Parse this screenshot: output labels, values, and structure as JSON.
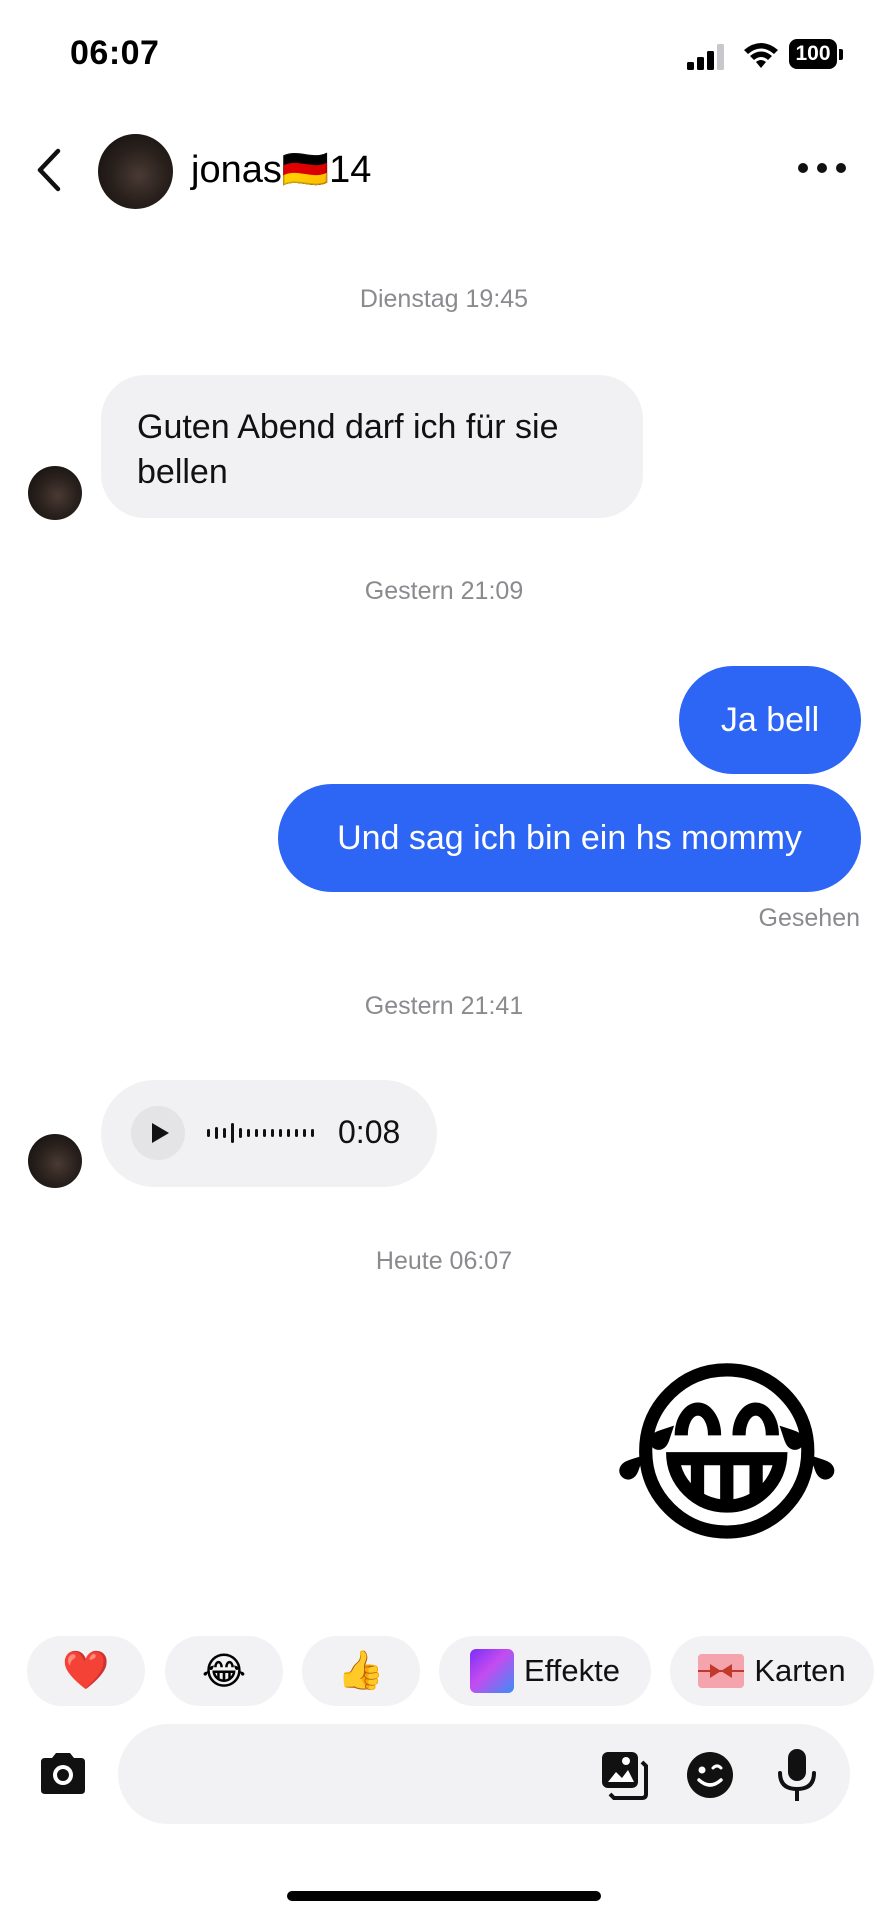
{
  "status_bar": {
    "time": "06:07",
    "battery": "100"
  },
  "header": {
    "name": "jonas🇩🇪14"
  },
  "messages": {
    "ts1": "Dienstag 19:45",
    "in1": "Guten Abend darf ich für sie bellen",
    "ts2": "Gestern 21:09",
    "out1": "Ja bell",
    "out2": "Und sag ich bin ein hs mommy",
    "seen": "Gesehen",
    "ts3": "Gestern 21:41",
    "voice_duration": "0:08",
    "ts4": "Heute 06:07",
    "emoji": "😂"
  },
  "quick_reactions": {
    "heart": "❤️",
    "laugh": "😂",
    "thumbs": "👍",
    "effekte_label": "Effekte",
    "karten_label": "Karten"
  },
  "composer": {
    "placeholder": ""
  },
  "colors": {
    "outgoing_bubble": "#2d66f5",
    "incoming_bubble": "#f1f1f3"
  },
  "icons": [
    "back-arrow-icon",
    "more-icon",
    "play-icon",
    "camera-icon",
    "gallery-icon",
    "sticker-icon",
    "mic-icon",
    "signal-icon",
    "wifi-icon",
    "battery-icon"
  ]
}
